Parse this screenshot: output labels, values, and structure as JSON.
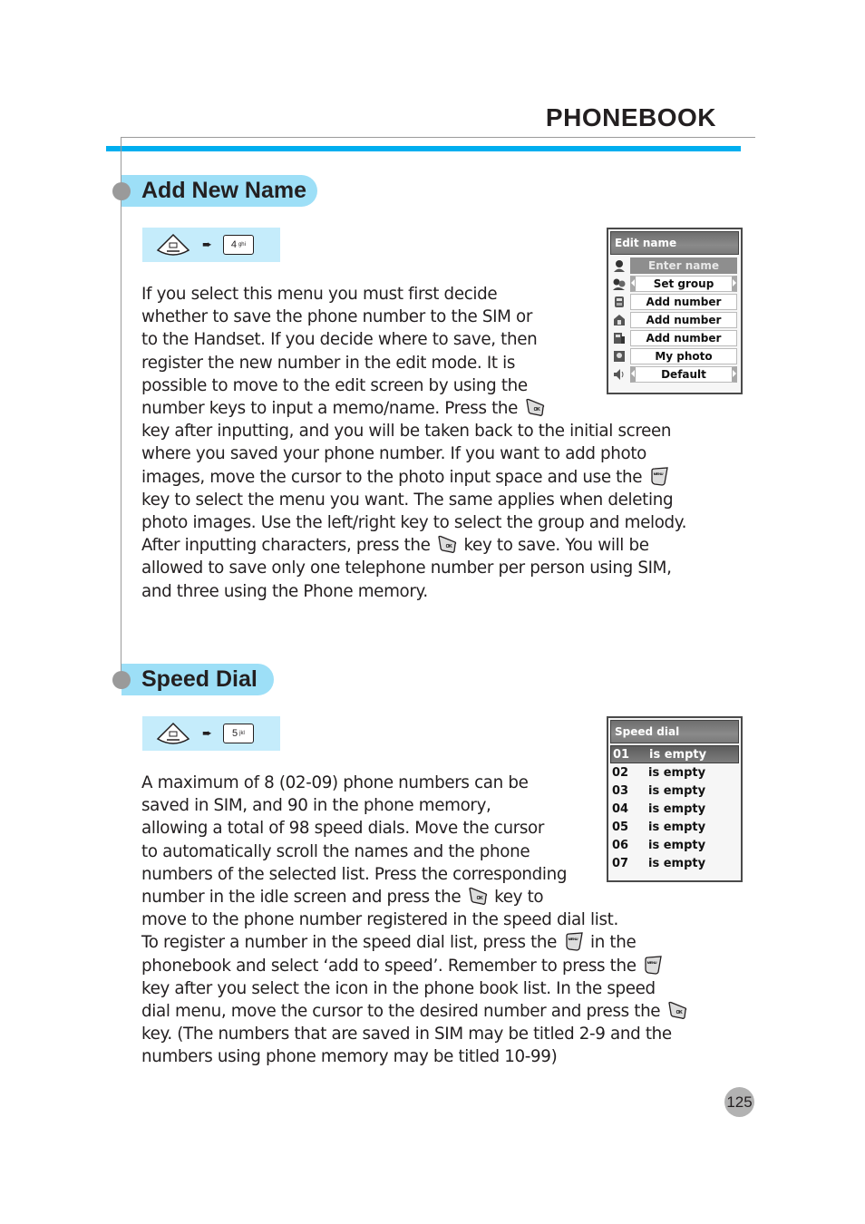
{
  "header": {
    "title": "PHONEBOOK"
  },
  "sections": [
    {
      "heading": "Add New Name",
      "key_sequence": {
        "nav_key": "phonebook-nav-key",
        "arrow": "➨",
        "num_key": "4",
        "num_key_letters": "ghi"
      },
      "screen": {
        "title": "Edit name",
        "rows": [
          {
            "icon": "person-icon",
            "label": "Enter name",
            "state": "active"
          },
          {
            "icon": "group-icon",
            "label": "Set group",
            "state": "arrows"
          },
          {
            "icon": "mobile-icon",
            "label": "Add number",
            "state": "normal"
          },
          {
            "icon": "home-icon",
            "label": "Add number",
            "state": "normal"
          },
          {
            "icon": "office-icon",
            "label": "Add number",
            "state": "normal"
          },
          {
            "icon": "photo-icon",
            "label": "My photo",
            "state": "normal"
          },
          {
            "icon": "speaker-icon",
            "label": "Default",
            "state": "arrows"
          }
        ]
      },
      "lines": [
        "If you select this menu you must first decide",
        "whether to save the phone number to the SIM or",
        "to the Handset. If you decide where to save, then",
        "register the new number in the edit mode. It is",
        "possible to move to the edit screen by using the",
        [
          "number keys to input a memo/name. Press the ",
          "ok-key",
          ""
        ],
        "key after inputting, and you will be taken back to the initial screen",
        "where you saved your phone number. If you want to add photo",
        [
          "images, move the cursor to the photo input space and use the ",
          "menu-key",
          ""
        ],
        "key to select the menu you want. The same applies when deleting",
        "photo images. Use the left/right key to select the group and melody.",
        [
          "After inputting characters, press the ",
          "ok-key",
          " key to save. You will be"
        ],
        "allowed to save only one telephone number per person using SIM,",
        "and three using the Phone memory."
      ]
    },
    {
      "heading": "Speed Dial",
      "key_sequence": {
        "nav_key": "phonebook-nav-key",
        "arrow": "➨",
        "num_key": "5",
        "num_key_letters": "jkl"
      },
      "screen": {
        "title": "Speed dial",
        "rows": [
          {
            "num": "01",
            "label": "is empty",
            "selected": true
          },
          {
            "num": "02",
            "label": "is empty",
            "selected": false
          },
          {
            "num": "03",
            "label": "is empty",
            "selected": false
          },
          {
            "num": "04",
            "label": "is empty",
            "selected": false
          },
          {
            "num": "05",
            "label": "is empty",
            "selected": false
          },
          {
            "num": "06",
            "label": "is empty",
            "selected": false
          },
          {
            "num": "07",
            "label": "is empty",
            "selected": false
          }
        ]
      },
      "lines": [
        "A maximum of 8 (02-09) phone numbers can be",
        "saved in SIM, and 90 in the phone memory,",
        "allowing a total of 98 speed dials. Move the cursor",
        "to automatically scroll the names and the phone",
        "numbers of the selected list. Press the corresponding",
        [
          "number in the idle screen and press the ",
          "ok-key",
          " key to"
        ],
        "move to the phone number registered in the speed dial list.",
        [
          "To register a number in the speed dial list, press the ",
          "menu-key",
          " in the"
        ],
        [
          "phonebook and select ‘add to speed’. Remember to press the ",
          "menu-key",
          ""
        ],
        "key after you select the icon in the phone book list. In the speed",
        [
          "dial menu, move the cursor to the desired number and press the ",
          "ok-key",
          ""
        ],
        "key. (The numbers that are saved in SIM may be titled 2-9 and the",
        "numbers using phone memory may be titled 10-99)"
      ]
    }
  ],
  "footer": {
    "page_number": "125"
  },
  "colors": {
    "accent_blue": "#00aeef",
    "pill_blue": "#9ddff7",
    "keybar_blue": "#c5ecfb",
    "grey": "#9a9a9a"
  }
}
